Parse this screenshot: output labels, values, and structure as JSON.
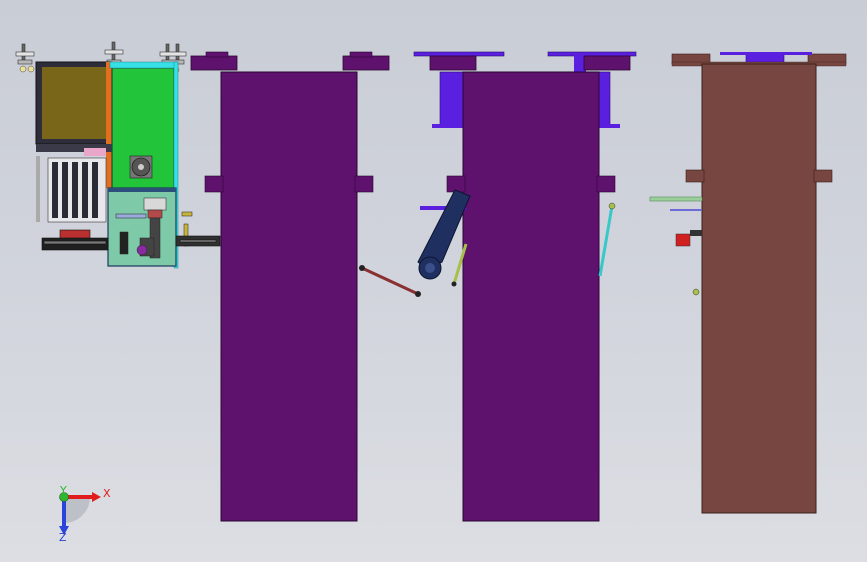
{
  "viewport": {
    "colors": {
      "background_top": "#c9cdd6",
      "background_bottom": "#dcdee3",
      "purple_body": "#5f116e",
      "violet_part": "#5b1fe0",
      "brown_body": "#784640",
      "green_panel": "#22c43a",
      "olive_panel": "#7a6618",
      "cyan_frame": "#37e0e6",
      "steel_dark": "#1f3060"
    }
  },
  "axes": {
    "x_label": "X",
    "y_label": "Y",
    "z_label": "Z",
    "x_color": "#e01c1c",
    "y_color": "#2fb52f",
    "z_color": "#2a43d8"
  }
}
